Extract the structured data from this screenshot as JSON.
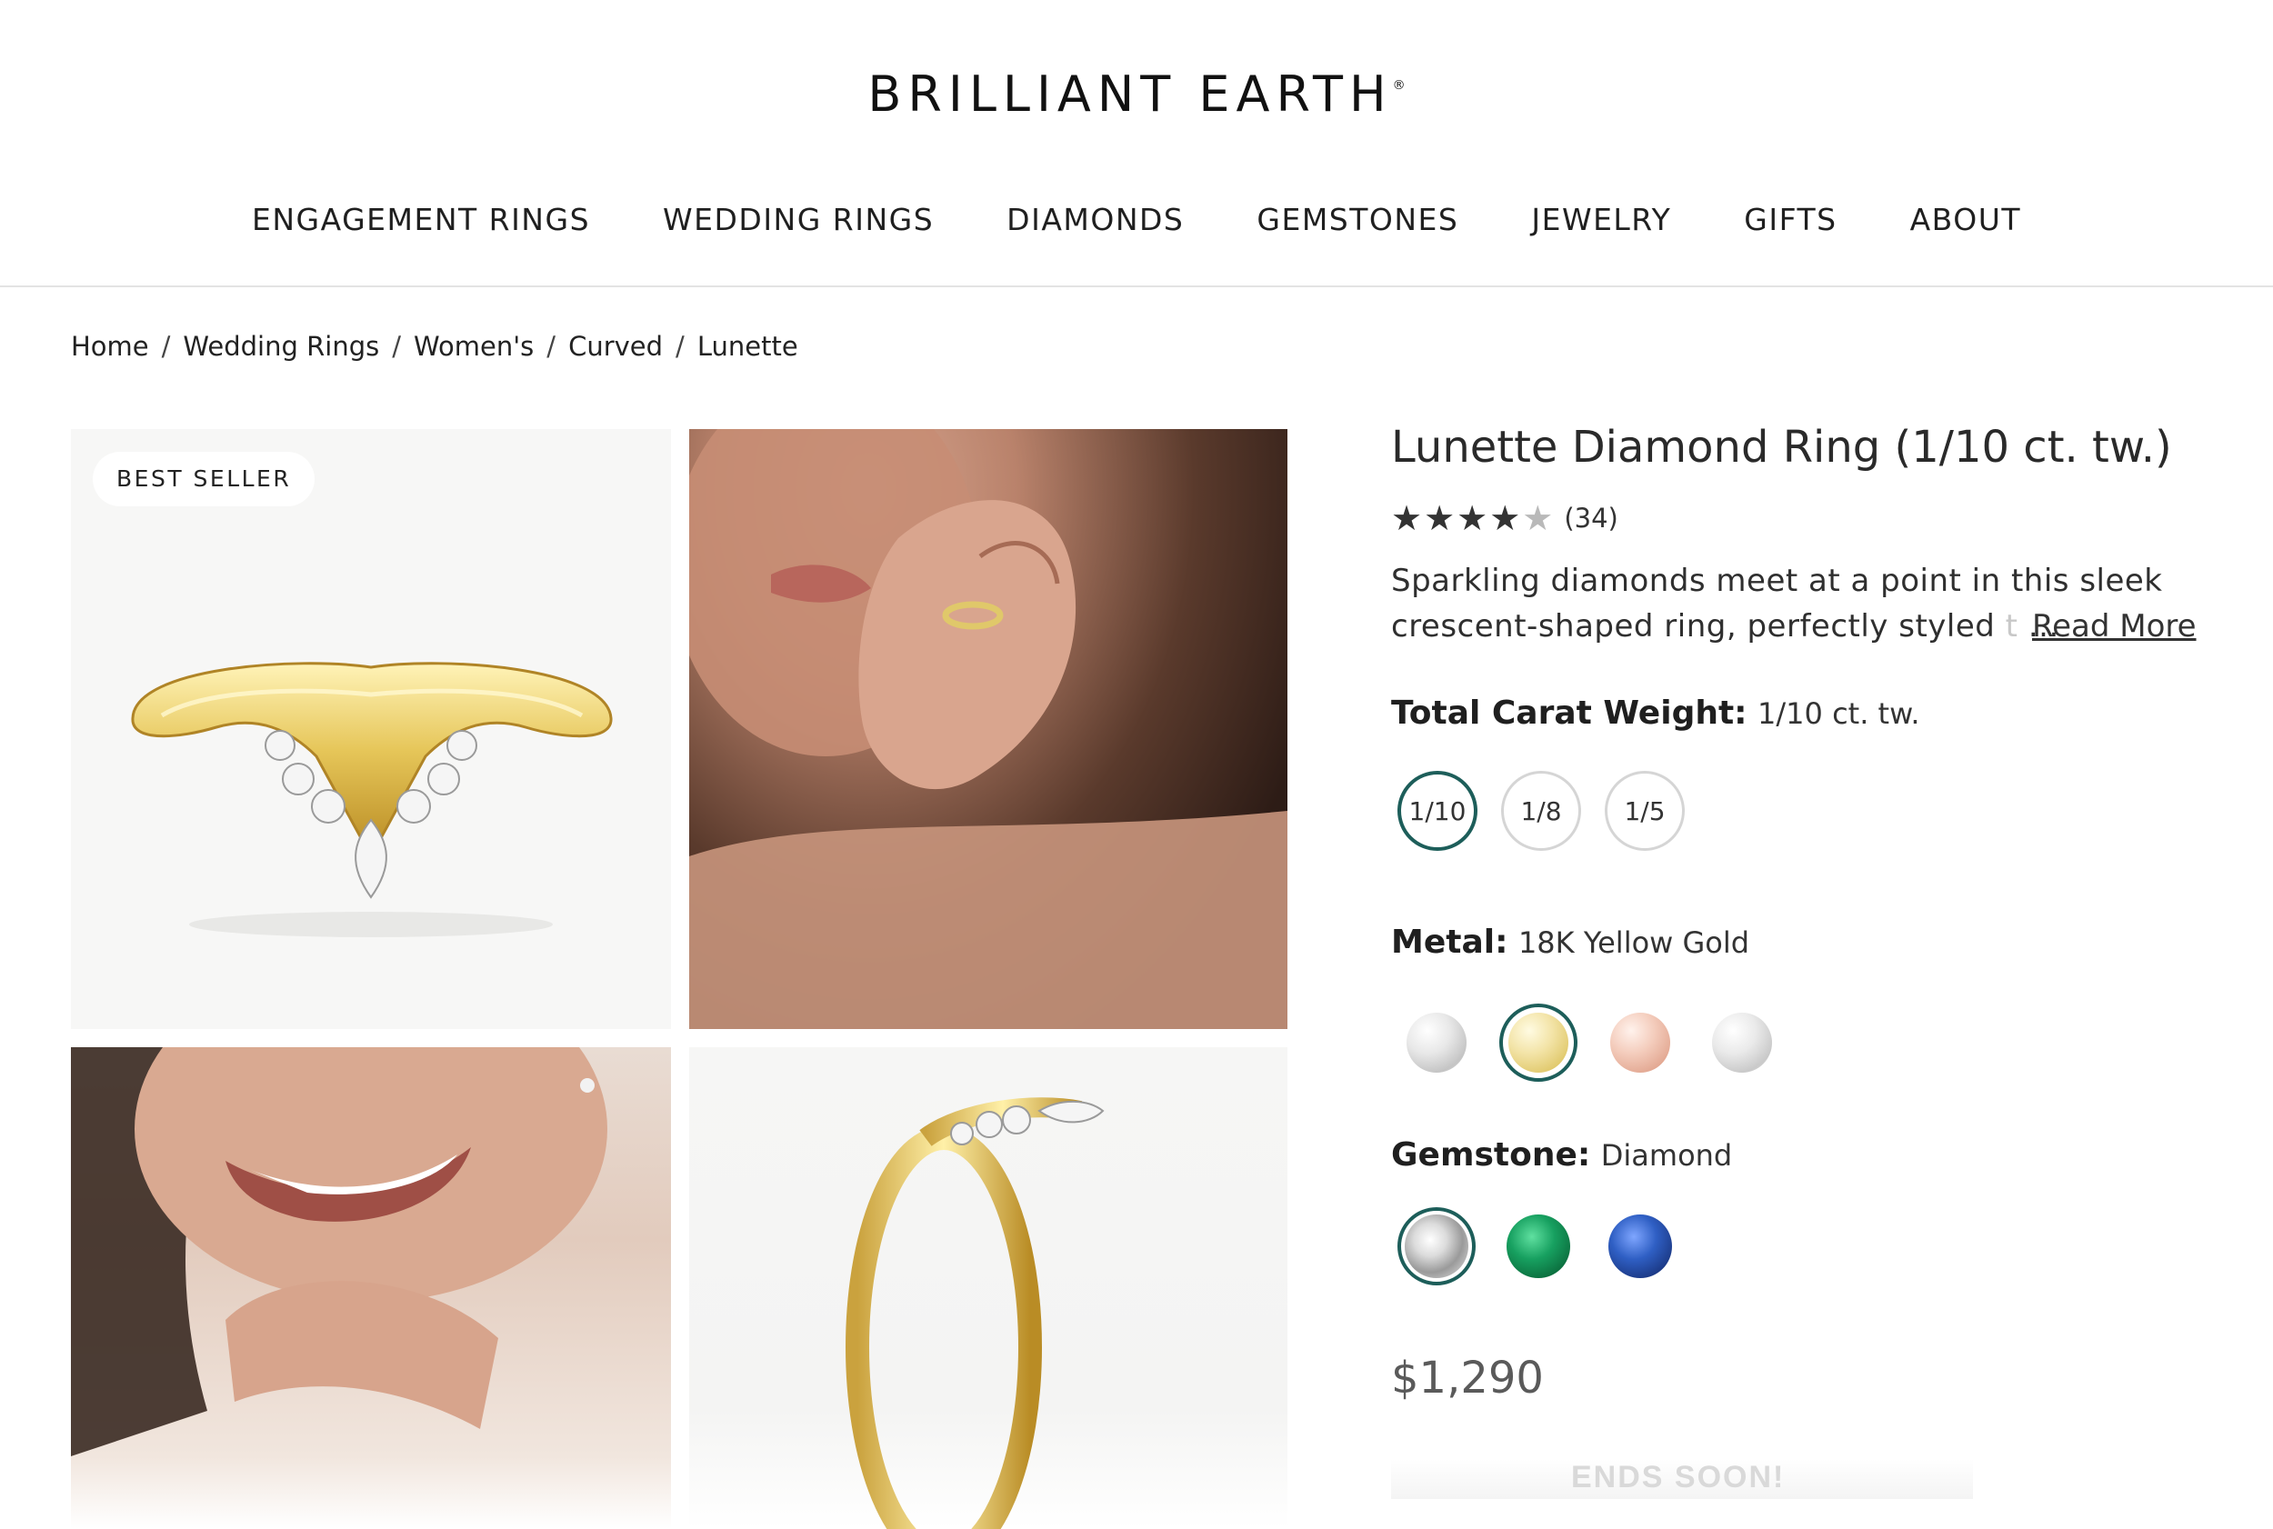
{
  "brand": {
    "name": "BRILLIANT EARTH",
    "mark": "®"
  },
  "nav": [
    "ENGAGEMENT RINGS",
    "WEDDING RINGS",
    "DIAMONDS",
    "GEMSTONES",
    "JEWELRY",
    "GIFTS",
    "ABOUT"
  ],
  "breadcrumb": [
    "Home",
    "Wedding Rings",
    "Women's",
    "Curved",
    "Lunette"
  ],
  "breadcrumb_separator": "/",
  "badge": "BEST SELLER",
  "product": {
    "title": "Lunette Diamond Ring (1/10 ct. tw.)",
    "stars_full": "★★★★",
    "stars_half": "★",
    "rating_value": 4.5,
    "reviews": "(34)",
    "description_line1": "Sparkling diamonds meet at a point in this sleek",
    "description_line2": "crescent-shaped ring, perfectly styled",
    "description_fade": "t",
    "description_ellipsis": "...",
    "read_more": "Read More",
    "carat_label": "Total Carat Weight:",
    "carat_value": "1/10 ct. tw.",
    "carat_options": [
      "1/10",
      "1/8",
      "1/5"
    ],
    "carat_selected": "1/10",
    "metal_label": "Metal:",
    "metal_value": "18K Yellow Gold",
    "metal_options": [
      "white-gold-swatch",
      "yellow-gold-swatch",
      "rose-gold-swatch",
      "platinum-swatch"
    ],
    "gemstone_label": "Gemstone:",
    "gemstone_value": "Diamond",
    "gemstone_options": [
      "diamond-swatch",
      "emerald-swatch",
      "sapphire-swatch"
    ],
    "price": "$1,290",
    "promo": "ENDS SOON!"
  },
  "colors": {
    "accent": "#1d5e5a",
    "gold": "#e0c86a"
  }
}
